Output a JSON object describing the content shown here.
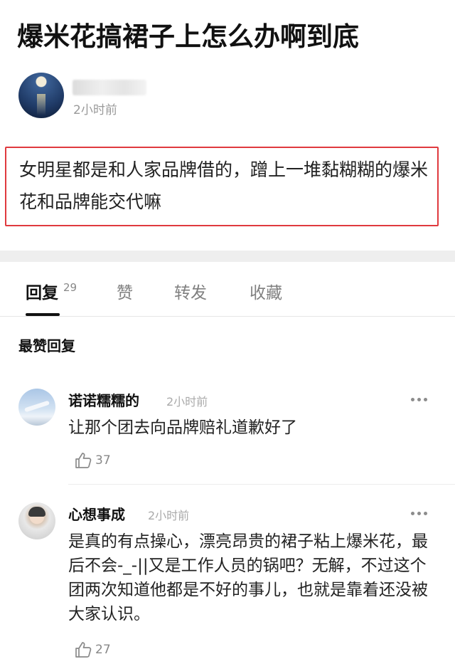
{
  "post": {
    "title": "爆米花搞裙子上怎么办啊到底",
    "author_avatar": "moon-over-sea-avatar",
    "author_name_blurred": true,
    "time": "2小时前",
    "body": "女明星都是和人家品牌借的，蹭上一堆黏糊糊的爆米花和品牌能交代嘛",
    "highlight_color": "#e0393e"
  },
  "tabs": [
    {
      "label": "回复",
      "count": "29",
      "active": true
    },
    {
      "label": "赞",
      "active": false
    },
    {
      "label": "转发",
      "active": false
    },
    {
      "label": "收藏",
      "active": false
    }
  ],
  "section_label": "最赞回复",
  "comments": [
    {
      "name": "诺诺糯糯的",
      "time": "2小时前",
      "text": "让那个团去向品牌赔礼道歉好了",
      "likes": "37",
      "avatar": "airplane-sky-avatar"
    },
    {
      "name": "心想事成",
      "time": "2小时前",
      "text": "是真的有点操心，漂亮昂贵的裙子粘上爆米花，最后不会-_-||又是工作人员的锅吧？无解，不过这个团两次知道他都是不好的事儿，也就是靠着还没被大家认识。",
      "likes": "27",
      "avatar": "person-photo-avatar"
    }
  ],
  "icons": {
    "more": "more-dots-icon",
    "like": "thumbs-up-icon"
  }
}
